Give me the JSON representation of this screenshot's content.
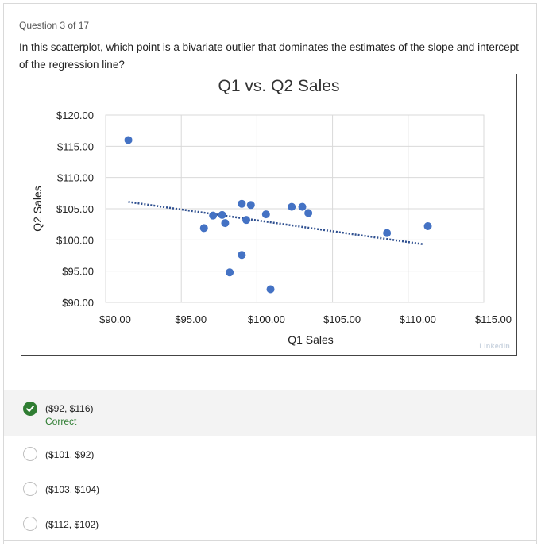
{
  "question": {
    "number_label": "Question 3 of 17",
    "text": "In this scatterplot, which point is a bivariate outlier that dominates the estimates of the slope and intercept of the regression line?"
  },
  "chart_data": {
    "type": "scatter",
    "title": "Q1 vs. Q2 Sales",
    "xlabel": "Q1 Sales",
    "ylabel": "Q2 Sales",
    "xlim": [
      90,
      115
    ],
    "ylim": [
      90,
      120
    ],
    "x_ticks": [
      "$90.00",
      "$95.00",
      "$100.00",
      "$105.00",
      "$110.00",
      "$115.00"
    ],
    "y_ticks": [
      "$120.00",
      "$115.00",
      "$110.00",
      "$105.00",
      "$100.00",
      "$95.00",
      "$90.00"
    ],
    "grid": true,
    "trendline": {
      "style": "dotted",
      "x": [
        91.5,
        111
      ],
      "y": [
        106.1,
        99.3
      ]
    },
    "points": [
      {
        "x": 91.5,
        "y": 116.0
      },
      {
        "x": 96.5,
        "y": 101.9
      },
      {
        "x": 97.1,
        "y": 103.9
      },
      {
        "x": 97.7,
        "y": 104.0
      },
      {
        "x": 97.9,
        "y": 102.7
      },
      {
        "x": 98.2,
        "y": 94.8
      },
      {
        "x": 99.0,
        "y": 105.8
      },
      {
        "x": 99.0,
        "y": 97.6
      },
      {
        "x": 99.3,
        "y": 103.2
      },
      {
        "x": 99.6,
        "y": 105.6
      },
      {
        "x": 100.6,
        "y": 104.1
      },
      {
        "x": 100.9,
        "y": 92.1
      },
      {
        "x": 102.3,
        "y": 105.3
      },
      {
        "x": 103.0,
        "y": 105.3
      },
      {
        "x": 103.4,
        "y": 104.3
      },
      {
        "x": 108.6,
        "y": 101.1
      },
      {
        "x": 111.3,
        "y": 102.2
      }
    ],
    "point_color": "#4472c4",
    "trend_color": "#2e4f8f",
    "watermark": "LinkedIn"
  },
  "answers": [
    {
      "label": "($92, $116)",
      "status": "Correct",
      "selected": true
    },
    {
      "label": "($101, $92)",
      "selected": false
    },
    {
      "label": "($103, $104)",
      "selected": false
    },
    {
      "label": "($112, $102)",
      "selected": false
    }
  ]
}
